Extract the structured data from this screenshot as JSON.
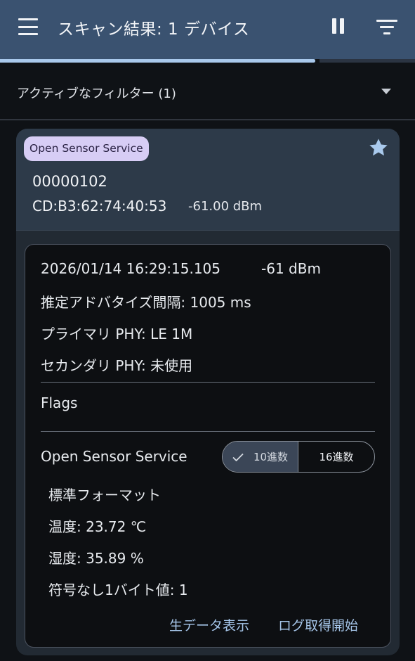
{
  "appbar": {
    "title": "スキャン結果: 1 デバイス",
    "menu_icon": "menu-icon",
    "pause_icon": "pause-icon",
    "filter_icon": "filter-list-icon"
  },
  "scan_progress": 0.76,
  "filter": {
    "label": "アクティブなフィルター (1)"
  },
  "device": {
    "service_chip": "Open Sensor Service",
    "name": "00000102",
    "mac": "CD:B3:62:74:40:53",
    "rssi": "-61.00 dBm",
    "favorite_icon": "star-icon"
  },
  "packet": {
    "timestamp": "2026/01/14 16:29:15.105",
    "rssi": "-61 dBm",
    "adv_interval": "推定アドバタイズ間隔: 1005 ms",
    "primary_phy": "プライマリ PHY: LE 1M",
    "secondary_phy": "セカンダリ PHY: 未使用",
    "flags_label": "Flags",
    "service_title": "Open Sensor Service",
    "format_toggle": {
      "decimal": "10進数",
      "hex": "16進数",
      "selected": "decimal"
    },
    "format": "標準フォーマット",
    "temperature": "温度: 23.72 ℃",
    "humidity": "湿度: 35.89 %",
    "unsigned_byte": "符号なし1バイト値: 1",
    "actions": {
      "raw_data": "生データ表示",
      "start_log": "ログ取得開始"
    }
  },
  "colors": {
    "appbar": "#3a5270",
    "chip_bg": "#d7cdf5",
    "star": "#a9c9ec",
    "link": "#a6c6ea"
  }
}
